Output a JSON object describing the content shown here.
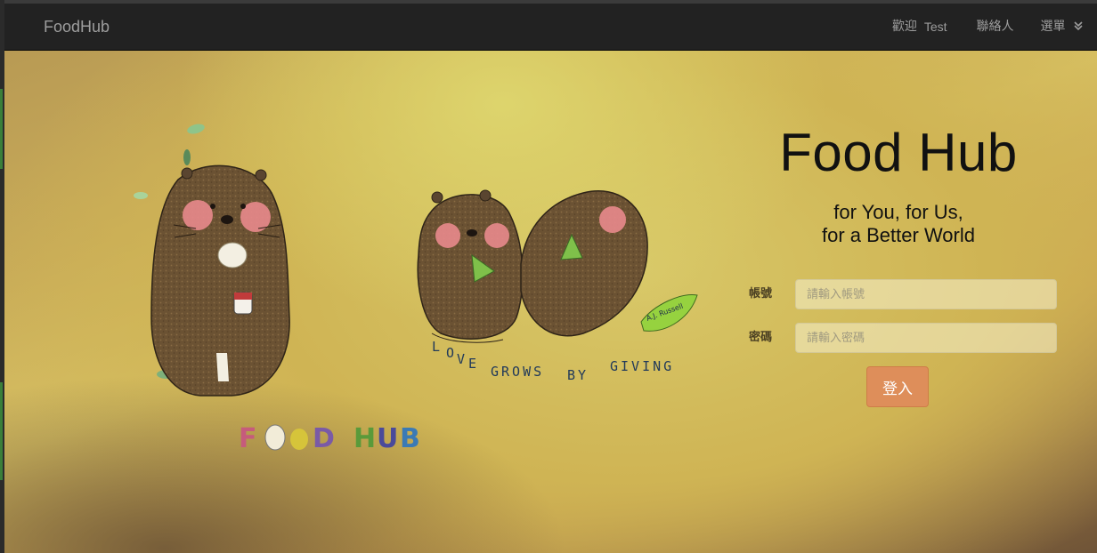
{
  "navbar": {
    "brand": "FoodHub",
    "welcome": "歡迎",
    "username": "Test",
    "contact": "聯絡人",
    "menu": "選單",
    "menu_icon": "double-chevron-down-icon"
  },
  "hero": {
    "title": "Food Hub",
    "subtitle_line1": "for You, for Us,",
    "subtitle_line2": "for a Better World",
    "illustration": {
      "logo_letters": [
        "F",
        "O",
        "O",
        "D",
        "H",
        "U",
        "B"
      ],
      "tagline": "LOVE GROWS BY GIVING",
      "signature": "A.J. Russell"
    }
  },
  "login": {
    "account_label": "帳號",
    "account_placeholder": "請輸入帳號",
    "account_value": "",
    "password_label": "密碼",
    "password_placeholder": "請輸入密碼",
    "password_value": "",
    "submit_label": "登入"
  },
  "colors": {
    "navbar_bg": "#222222",
    "nav_text": "#9d9d9d",
    "button": "#de8e5a",
    "hero_yellow": "#d8c868",
    "bear_brown": "#6b5233",
    "cheek_pink": "#e9898c"
  }
}
